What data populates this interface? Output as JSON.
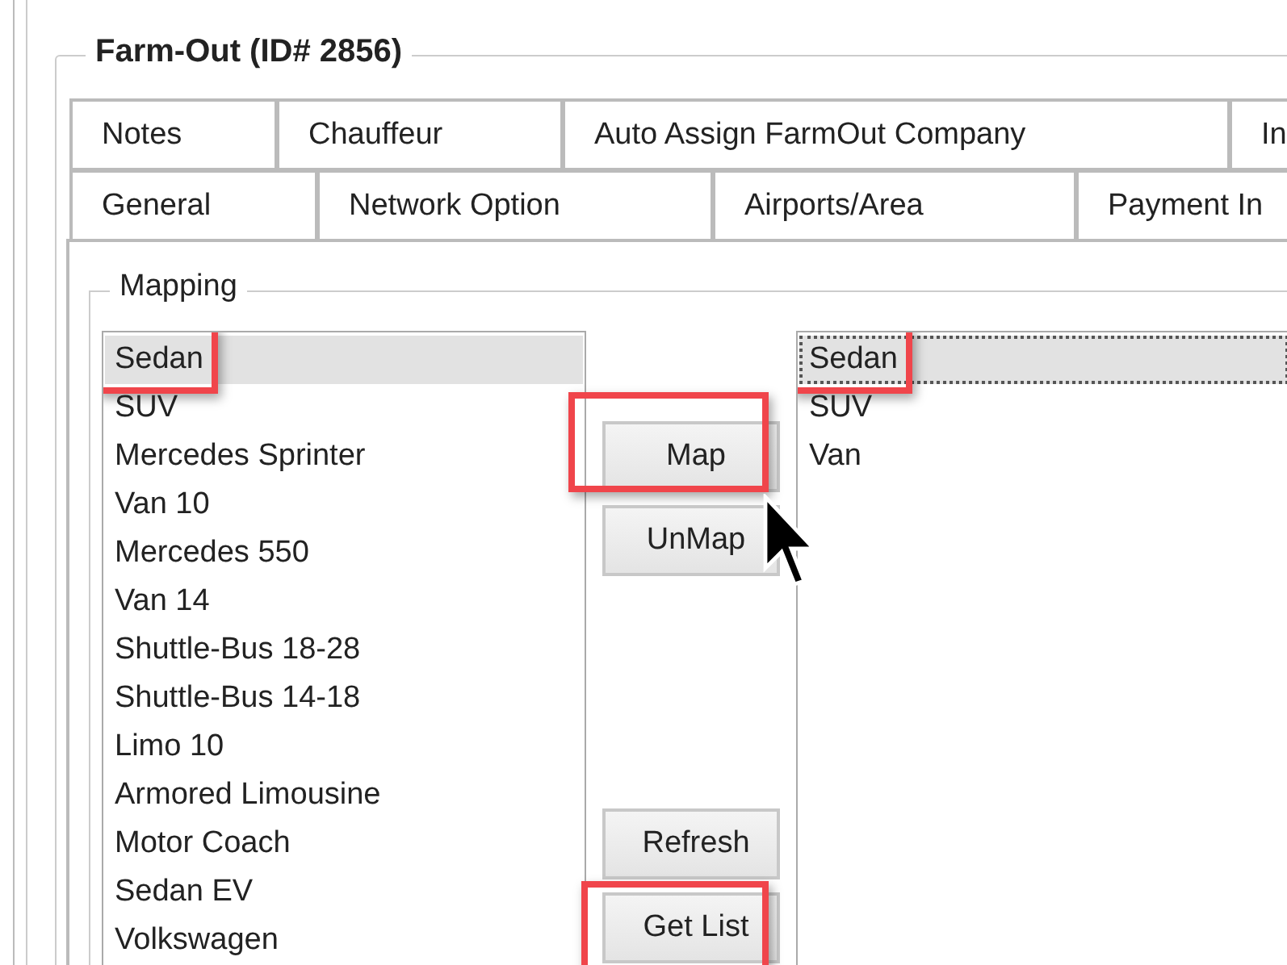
{
  "group": {
    "title": "Farm-Out (ID# 2856)"
  },
  "tab_rows": [
    [
      {
        "label": "Notes"
      },
      {
        "label": "Chauffeur"
      },
      {
        "label": "Auto Assign FarmOut Company"
      },
      {
        "label": "In"
      }
    ],
    [
      {
        "label": "General"
      },
      {
        "label": "Network Option"
      },
      {
        "label": "Airports/Area"
      },
      {
        "label": "Payment In"
      }
    ]
  ],
  "mapping": {
    "title": "Mapping",
    "left_list": {
      "has_focus": false,
      "items": [
        {
          "label": "Sedan",
          "selected": true,
          "highlighted": true
        },
        {
          "label": "SUV",
          "selected": false,
          "highlighted": false
        },
        {
          "label": "Mercedes Sprinter",
          "selected": false,
          "highlighted": false
        },
        {
          "label": "Van 10",
          "selected": false,
          "highlighted": false
        },
        {
          "label": "Mercedes 550",
          "selected": false,
          "highlighted": false
        },
        {
          "label": "Van 14",
          "selected": false,
          "highlighted": false
        },
        {
          "label": "Shuttle-Bus 18-28",
          "selected": false,
          "highlighted": false
        },
        {
          "label": "Shuttle-Bus 14-18",
          "selected": false,
          "highlighted": false
        },
        {
          "label": "Limo 10",
          "selected": false,
          "highlighted": false
        },
        {
          "label": "Armored Limousine",
          "selected": false,
          "highlighted": false
        },
        {
          "label": "Motor Coach",
          "selected": false,
          "highlighted": false
        },
        {
          "label": "Sedan EV",
          "selected": false,
          "highlighted": false
        },
        {
          "label": "Volkswagen",
          "selected": false,
          "highlighted": false
        }
      ]
    },
    "top_buttons": [
      {
        "label": "Map",
        "highlighted": true
      },
      {
        "label": "UnMap",
        "highlighted": false
      }
    ],
    "bottom_buttons": [
      {
        "label": "Refresh",
        "highlighted": false
      },
      {
        "label": "Get List",
        "highlighted": true
      }
    ],
    "right_list": {
      "has_focus": true,
      "items": [
        {
          "label": "Sedan",
          "selected": true,
          "highlighted": true
        },
        {
          "label": "SUV",
          "selected": false,
          "highlighted": false
        },
        {
          "label": "Van",
          "selected": false,
          "highlighted": false
        }
      ]
    }
  }
}
